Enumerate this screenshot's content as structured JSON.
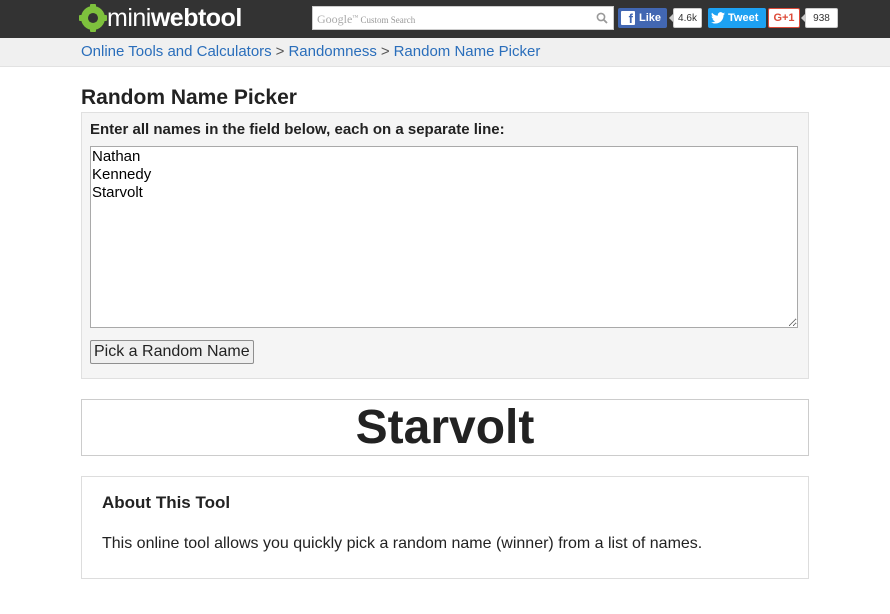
{
  "header": {
    "logo_prefix": "mini",
    "logo_suffix": "webtool",
    "search": {
      "brand": "Google",
      "trademark": "™",
      "hint": " Custom Search",
      "value": ""
    },
    "facebook": {
      "label": "Like",
      "count": "4.6k"
    },
    "twitter": {
      "label": "Tweet"
    },
    "googleplus": {
      "label": "G+1",
      "count": "938"
    }
  },
  "breadcrumb": {
    "items": [
      "Online Tools and Calculators",
      "Randomness",
      "Random Name Picker"
    ],
    "separator": ">"
  },
  "main": {
    "title": "Random Name Picker",
    "form": {
      "label": "Enter all names in the field below, each on a separate line:",
      "names_value": "Nathan\nKennedy\nStarvolt",
      "button_label": "Pick a Random Name"
    },
    "result": "Starvolt",
    "about": {
      "title": "About This Tool",
      "text": "This online tool allows you quickly pick a random name (winner) from a list of names."
    }
  },
  "colors": {
    "topbar": "#333333",
    "logo_green": "#7ec13d",
    "link": "#2a6ebb",
    "facebook": "#4267b2",
    "twitter": "#1da1f2",
    "googleplus": "#dd4b39"
  }
}
